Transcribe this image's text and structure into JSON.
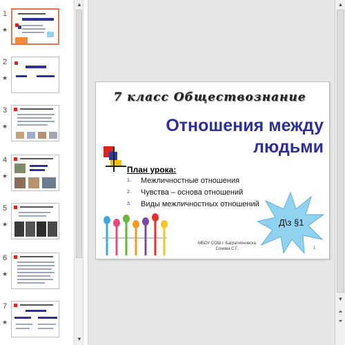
{
  "thumbnails": [
    {
      "number": "1",
      "active": true
    },
    {
      "number": "2",
      "active": false
    },
    {
      "number": "3",
      "active": false
    },
    {
      "number": "4",
      "active": false
    },
    {
      "number": "5",
      "active": false
    },
    {
      "number": "6",
      "active": false
    },
    {
      "number": "7",
      "active": false
    }
  ],
  "thumb_star": "★",
  "slide": {
    "grade_title": "7 класс  Обществознание",
    "main_title_line1": "Отношения между",
    "main_title_line2": "людьми",
    "plan_heading": "План урока:",
    "plan_items": [
      {
        "num": "1.",
        "text": "Межличностные отношения"
      },
      {
        "num": "2.",
        "text": "Чувства – основа отношений"
      },
      {
        "num": "3.",
        "text": "Виды межличностных отношений"
      }
    ],
    "homework": "Д\\з §1",
    "school_line1": "МБОУ СОШ г. Багратионовска",
    "school_line2": "Сонова С.Г.",
    "slide_number": "1"
  },
  "colors": {
    "title_blue": "#2d2f9a",
    "burst_fill": "#8fd3f0",
    "active_border": "#e8744a",
    "square_red": "#e0231c",
    "square_blue": "#2b3c9e",
    "square_yellow": "#f2c200"
  },
  "icons": {
    "scroll_up": "up-arrow-icon",
    "scroll_down": "down-arrow-icon",
    "prev_slide": "double-up-arrow-icon",
    "next_slide": "double-down-arrow-icon"
  }
}
